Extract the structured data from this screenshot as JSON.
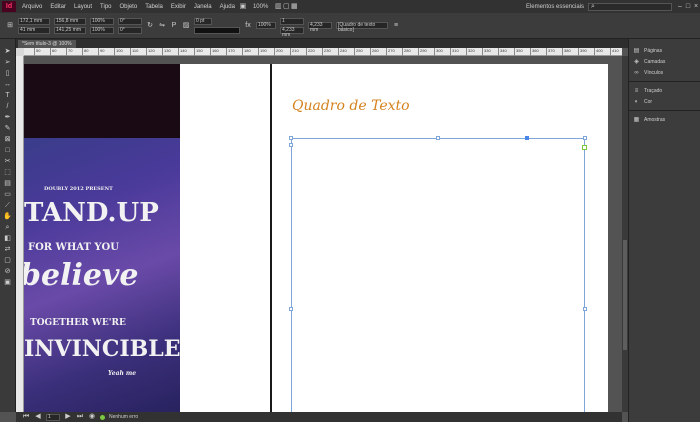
{
  "app": {
    "logo": "Id"
  },
  "menu": [
    "Arquivo",
    "Editar",
    "Layout",
    "Tipo",
    "Objeto",
    "Tabela",
    "Exibir",
    "Janela",
    "Ajuda"
  ],
  "menubar": {
    "zoom": "100%",
    "workspace": "Elementos essenciais",
    "search_placeholder": ""
  },
  "control": {
    "x": "172,1 mm",
    "y": "41 mm",
    "w": "156,8 mm",
    "h": "141,25 mm",
    "scale_x": "100%",
    "scale_y": "100%",
    "rotate": "0°",
    "shear": "0°",
    "stroke": "0 pt",
    "opacity": "100%",
    "frame_w": "4,233 mm",
    "frame_type": "[Quadro de texto básico]",
    "cols": "1",
    "gutter": "4,233 mm"
  },
  "document": {
    "tab_title": "*Sem título-3 @ 100%"
  },
  "ruler": {
    "ticks": [
      "50",
      "60",
      "70",
      "80",
      "90",
      "100",
      "110",
      "120",
      "130",
      "140",
      "150",
      "160",
      "170",
      "180",
      "190",
      "200",
      "210",
      "220",
      "230",
      "240",
      "250",
      "260",
      "270",
      "280",
      "290",
      "300",
      "310",
      "320",
      "330",
      "340",
      "350",
      "360",
      "370",
      "380",
      "390",
      "400",
      "410"
    ]
  },
  "poster": {
    "line1": "DOUBLY 2012 PRESENT",
    "line2": "TAND.UP",
    "line3": "FOR WHAT YOU",
    "line4": "believe",
    "line5": "TOGETHER WE'RE",
    "line6": "INVINCIBLE",
    "line7": "Yeah me"
  },
  "page": {
    "heading": "Quadro de Texto",
    "heading_color": "#d4821e"
  },
  "status": {
    "page": "1",
    "preflight": "Nenhum erro"
  },
  "panels": [
    {
      "icon": "pages-icon",
      "glyph": "▤",
      "label": "Páginas"
    },
    {
      "icon": "layers-icon",
      "glyph": "◈",
      "label": "Camadas"
    },
    {
      "icon": "links-icon",
      "glyph": "∞",
      "label": "Vínculos"
    },
    {
      "icon": "stroke-icon",
      "glyph": "≡",
      "label": "Traçado"
    },
    {
      "icon": "color-icon",
      "glyph": "◐",
      "label": "Cor"
    },
    {
      "icon": "swatches-icon",
      "glyph": "▦",
      "label": "Amostras"
    }
  ]
}
